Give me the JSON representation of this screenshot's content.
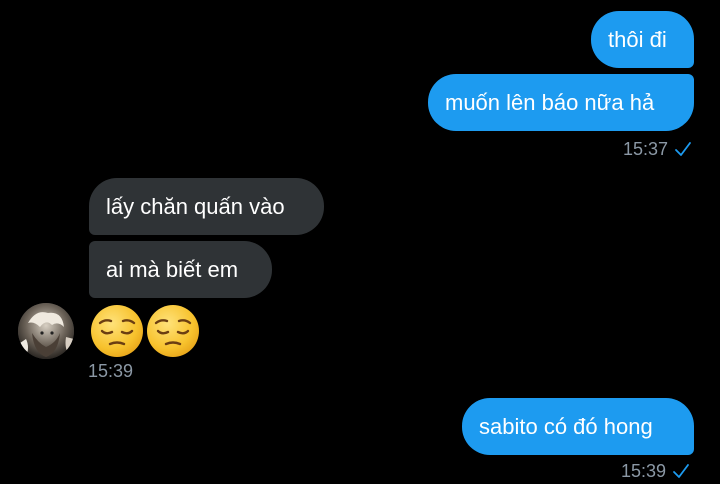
{
  "colors": {
    "background": "#000000",
    "outgoing_bubble": "#1d9bf0",
    "incoming_bubble": "#2f3336",
    "timestamp": "#8b98a5",
    "read_check": "#1d9bf0"
  },
  "messages": {
    "out_1": {
      "text": "thôi đi"
    },
    "out_2": {
      "text": "muốn lên báo nữa hả"
    },
    "out_group_1_time": "15:37",
    "in_1": {
      "text": "lấy chăn quấn vào"
    },
    "in_2": {
      "text": "ai mà biết em"
    },
    "in_emoji": {
      "emoji_1": "pensive-face",
      "emoji_2": "pensive-face"
    },
    "in_group_time": "15:39",
    "out_3": {
      "text": "sabito có đó hong"
    },
    "out_group_2_time": "15:39"
  },
  "icons": {
    "read_receipt": "check-icon",
    "avatar": "user-avatar"
  }
}
